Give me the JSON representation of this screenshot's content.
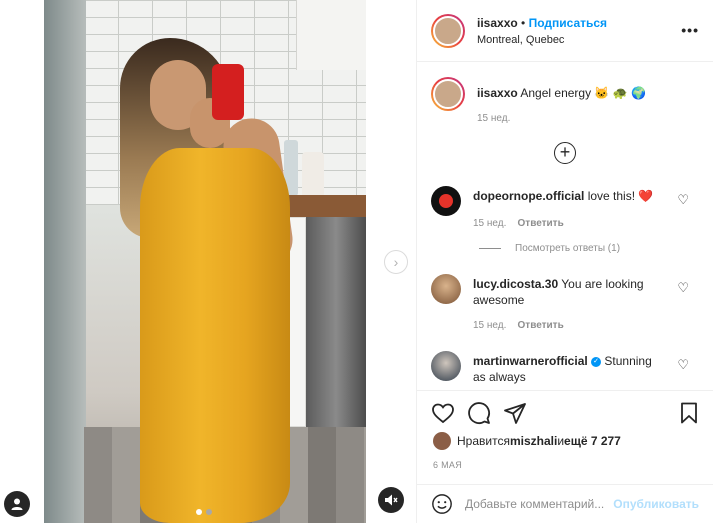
{
  "post": {
    "username": "iisaxxo",
    "separator": " • ",
    "follow_label": "Подписаться",
    "location": "Montreal, Quebec",
    "more_label": "•••"
  },
  "caption": {
    "username": "iisaxxo",
    "text": "Angel energy 🐱 🐢 🌍",
    "time": "15 нед."
  },
  "comments": [
    {
      "username": "dopeornope.official",
      "text": "love this! ❤️",
      "time": "15 нед.",
      "reply_label": "Ответить",
      "view_replies": "Посмотреть ответы (1)"
    },
    {
      "username": "lucy.dicosta.30",
      "text": "You are looking awesome",
      "time": "15 нед.",
      "reply_label": "Ответить"
    },
    {
      "username": "martinwarnerofficial",
      "text": "Stunning as always"
    }
  ],
  "likes": {
    "prefix": "Нравится ",
    "user": "miszhali",
    "middle": " и ",
    "count": "ещё 7 277"
  },
  "date": "6 МАЯ",
  "add_comment": {
    "placeholder": "Добавьте комментарий...",
    "publish_label": "Опубликовать"
  },
  "colors": {
    "accent": "#0095f6",
    "publish_disabled": "#b2dffc",
    "muted": "#8e8e8e",
    "heart_red": "#ed4956"
  },
  "carousel": {
    "total": 2,
    "active": 1
  }
}
